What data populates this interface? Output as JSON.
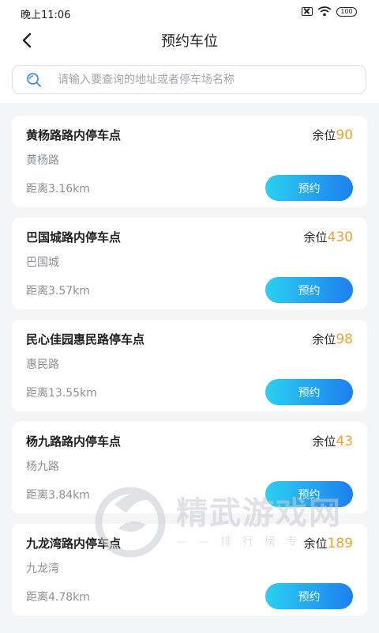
{
  "status_bar": {
    "time": "晚上11:06",
    "battery": "100"
  },
  "header": {
    "title": "预约车位"
  },
  "search": {
    "placeholder": "请输入要查询的地址或者停车场名称"
  },
  "remain_label": "余位",
  "reserve_label": "预约",
  "parking_list": [
    {
      "name": "黄杨路路内停车点",
      "road": "黄杨路",
      "distance": "距离3.16km",
      "remain": "90"
    },
    {
      "name": "巴国城路内停车点",
      "road": "巴国城",
      "distance": "距离3.57km",
      "remain": "430"
    },
    {
      "name": "民心佳园惠民路停车点",
      "road": "惠民路",
      "distance": "距离13.55km",
      "remain": "98"
    },
    {
      "name": "杨九路路内停车点",
      "road": "杨九路",
      "distance": "距离3.84km",
      "remain": "43"
    },
    {
      "name": "九龙湾路内停车点",
      "road": "九龙湾",
      "distance": "距离4.78km",
      "remain": "189"
    }
  ],
  "watermark": {
    "title": "精武游戏网",
    "subtitle": "——排行榜专"
  },
  "colors": {
    "accent_start": "#2bd0f0",
    "accent_end": "#1d7ff0",
    "remain_number": "#f2a234"
  }
}
